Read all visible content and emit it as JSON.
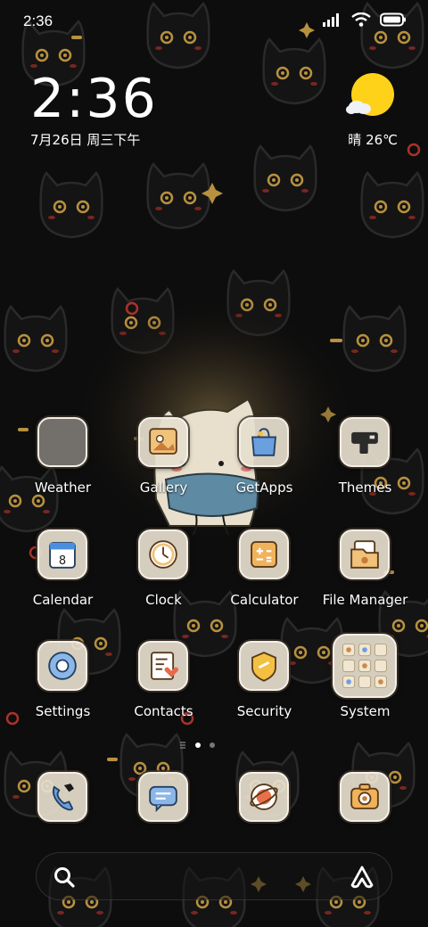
{
  "status_bar": {
    "time": "2:36",
    "icons": [
      "signal-icon",
      "wifi-icon",
      "battery-icon"
    ]
  },
  "clock_widget": {
    "time": "2:36",
    "date": "7月26日 周三下午"
  },
  "weather_widget": {
    "text": "晴 26℃",
    "icon": "sunny-icon"
  },
  "apps": [
    {
      "label": "Weather",
      "icon": "weather-icon"
    },
    {
      "label": "Gallery",
      "icon": "gallery-icon"
    },
    {
      "label": "GetApps",
      "icon": "getapps-icon"
    },
    {
      "label": "Themes",
      "icon": "themes-icon"
    },
    {
      "label": "Calendar",
      "icon": "calendar-icon",
      "day": "8"
    },
    {
      "label": "Clock",
      "icon": "clock-icon"
    },
    {
      "label": "Calculator",
      "icon": "calculator-icon"
    },
    {
      "label": "File Manager",
      "icon": "file-manager-icon"
    },
    {
      "label": "Settings",
      "icon": "settings-icon"
    },
    {
      "label": "Contacts",
      "icon": "contacts-icon"
    },
    {
      "label": "Security",
      "icon": "security-icon"
    },
    {
      "label": "System",
      "icon": "folder-icon"
    }
  ],
  "page_indicator": {
    "pages": 2,
    "current": 1
  },
  "dock": [
    {
      "icon": "phone-icon"
    },
    {
      "icon": "messages-icon"
    },
    {
      "icon": "browser-icon"
    },
    {
      "icon": "camera-icon"
    }
  ],
  "search_bar": {
    "left_icon": "search-icon",
    "right_icon": "assistant-icon"
  },
  "colors": {
    "background": "#0d0d0d",
    "tile": "#e6dece",
    "accent_gold": "#c9a24a",
    "accent_red": "#a8332a",
    "sun": "#ffd21a"
  }
}
